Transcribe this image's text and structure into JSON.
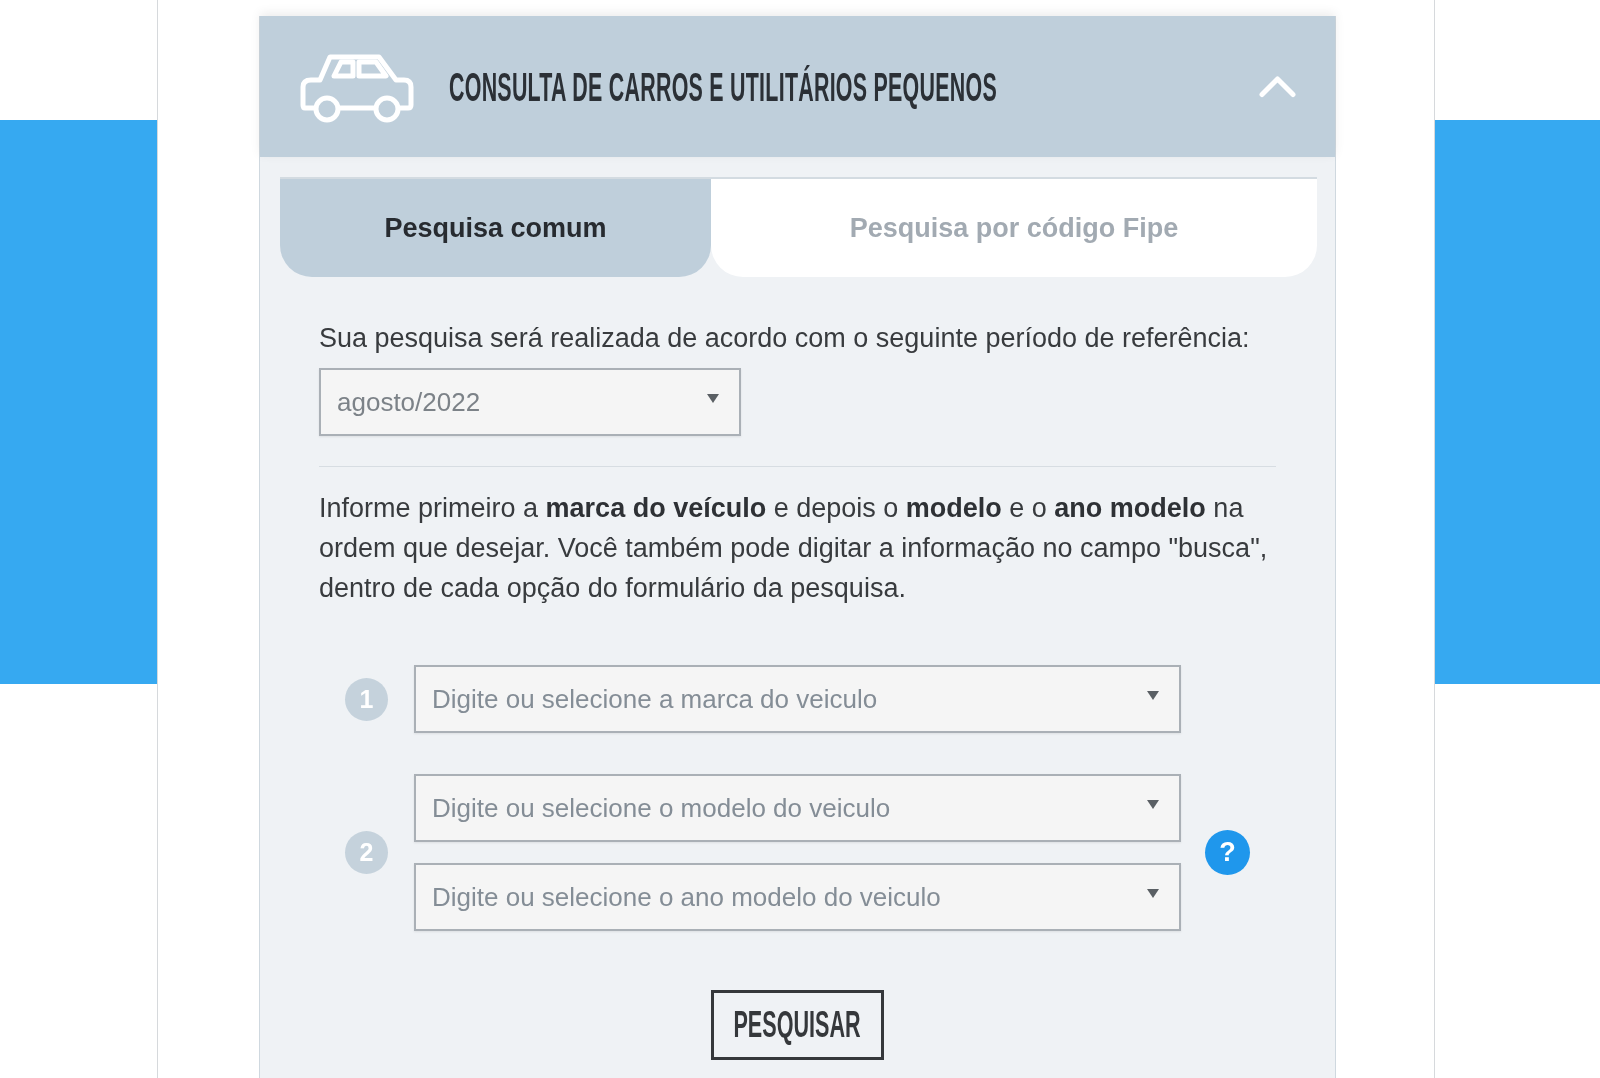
{
  "header": {
    "title": "CONSULTA DE CARROS E UTILITÁRIOS PEQUENOS",
    "expanded": true
  },
  "tabs": [
    {
      "label": "Pesquisa comum",
      "selected": true
    },
    {
      "label": "Pesquisa por código Fipe",
      "selected": false
    }
  ],
  "reference": {
    "text": "Sua pesquisa será realizada de acordo com o seguinte período de referência:",
    "period": {
      "value": "agosto/2022"
    }
  },
  "instructions": "Informe primeiro a **marca do veículo** e depois o **modelo** e o **ano modelo** na ordem que desejar. Você também pode digitar a informação no campo \"busca\", dentro de cada opção do formulário da pesquisa.",
  "steps": [
    {
      "number": "1",
      "fields": [
        {
          "placeholder": "Digite ou selecione a marca do veiculo"
        }
      ]
    },
    {
      "number": "2",
      "fields": [
        {
          "placeholder": "Digite ou selecione o modelo do veiculo"
        },
        {
          "placeholder": "Digite ou selecione o ano modelo do veiculo"
        }
      ],
      "help": "?"
    }
  ],
  "search_button": "PESQUISAR"
}
